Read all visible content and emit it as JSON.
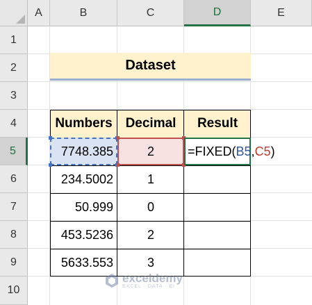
{
  "columns": [
    "A",
    "B",
    "C",
    "D",
    "E"
  ],
  "rows": [
    "1",
    "2",
    "3",
    "4",
    "5",
    "6",
    "7",
    "8",
    "9",
    "10"
  ],
  "active_column": "D",
  "active_row": "5",
  "title": "Dataset",
  "table": {
    "headers": [
      "Numbers",
      "Decimal",
      "Result"
    ],
    "rows": [
      {
        "number": "7748.385",
        "decimal": "2"
      },
      {
        "number": "234.5002",
        "decimal": "1"
      },
      {
        "number": "50.999",
        "decimal": "0"
      },
      {
        "number": "453.5236",
        "decimal": "2"
      },
      {
        "number": "5633.553",
        "decimal": "3"
      }
    ]
  },
  "formula": {
    "prefix": "=FIXED(",
    "ref1": "B5",
    "sep": ",",
    "ref2": "C5",
    "suffix": ")"
  },
  "watermark": {
    "name": "exceldemy",
    "tagline": "EXCEL · DATA · BI"
  },
  "colors": {
    "accent": "#217346",
    "header_fill": "#fff2cc",
    "ref_blue": "#4472c4",
    "ref_red": "#c0504d"
  }
}
